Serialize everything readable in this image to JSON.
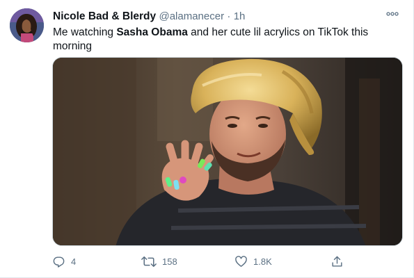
{
  "tweet": {
    "display_name": "Nicole Bad & Blerdy",
    "handle": "@alamanecer",
    "separator": "·",
    "time": "1h",
    "text_before": "Me watching ",
    "text_bold": "Sasha Obama",
    "text_after": " and her cute lil acrylics on TikTok this morning"
  },
  "actions": {
    "replies": "4",
    "retweets": "158",
    "likes": "1.8K"
  },
  "icons": {
    "more": "more-options-icon",
    "reply": "reply-icon",
    "retweet": "retweet-icon",
    "like": "heart-icon",
    "share": "share-icon"
  },
  "colors": {
    "secondary_text": "#5b7083",
    "primary_text": "#0f1419",
    "bonnet_gold": "#d9b25a"
  }
}
